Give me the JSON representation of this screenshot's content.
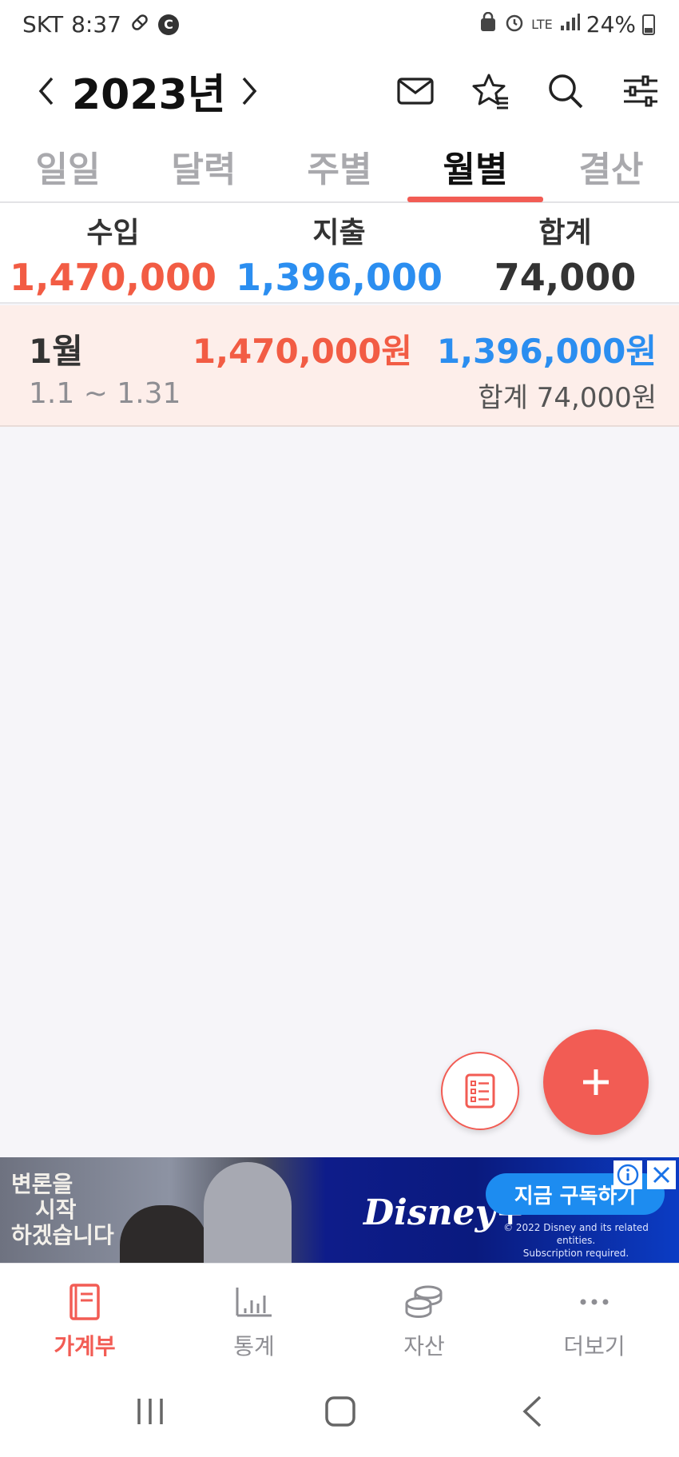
{
  "status_bar": {
    "carrier": "SKT",
    "time": "8:37",
    "network": "LTE",
    "battery": "24%"
  },
  "header": {
    "year": "2023년"
  },
  "tabs": [
    {
      "label": "일일"
    },
    {
      "label": "달력"
    },
    {
      "label": "주별"
    },
    {
      "label": "월별"
    },
    {
      "label": "결산"
    }
  ],
  "active_tab": "월별",
  "summary": {
    "income_label": "수입",
    "income_value": "1,470,000",
    "expense_label": "지출",
    "expense_value": "1,396,000",
    "total_label": "합계",
    "total_value": "74,000"
  },
  "months": [
    {
      "label": "1월",
      "range": "1.1 ~ 1.31",
      "income": "1,470,000원",
      "expense": "1,396,000원",
      "total": "합계 74,000원"
    }
  ],
  "ad": {
    "korean_text_line1": "변론을",
    "korean_text_line2": "시작",
    "korean_text_line3": "하겠습니다",
    "brand": "Disney+",
    "cta": "지금 구독하기",
    "legal_line1": "© 2022 Disney and its related entities.",
    "legal_line2": "Subscription required."
  },
  "bottom_nav": [
    {
      "label": "가계부",
      "icon": "ledger-book-icon"
    },
    {
      "label": "통계",
      "icon": "bar-chart-icon"
    },
    {
      "label": "자산",
      "icon": "coins-icon"
    },
    {
      "label": "더보기",
      "icon": "more-dots-icon"
    }
  ],
  "colors": {
    "accent": "#f25c54",
    "income": "#f25c44",
    "expense": "#2b8ef0"
  }
}
